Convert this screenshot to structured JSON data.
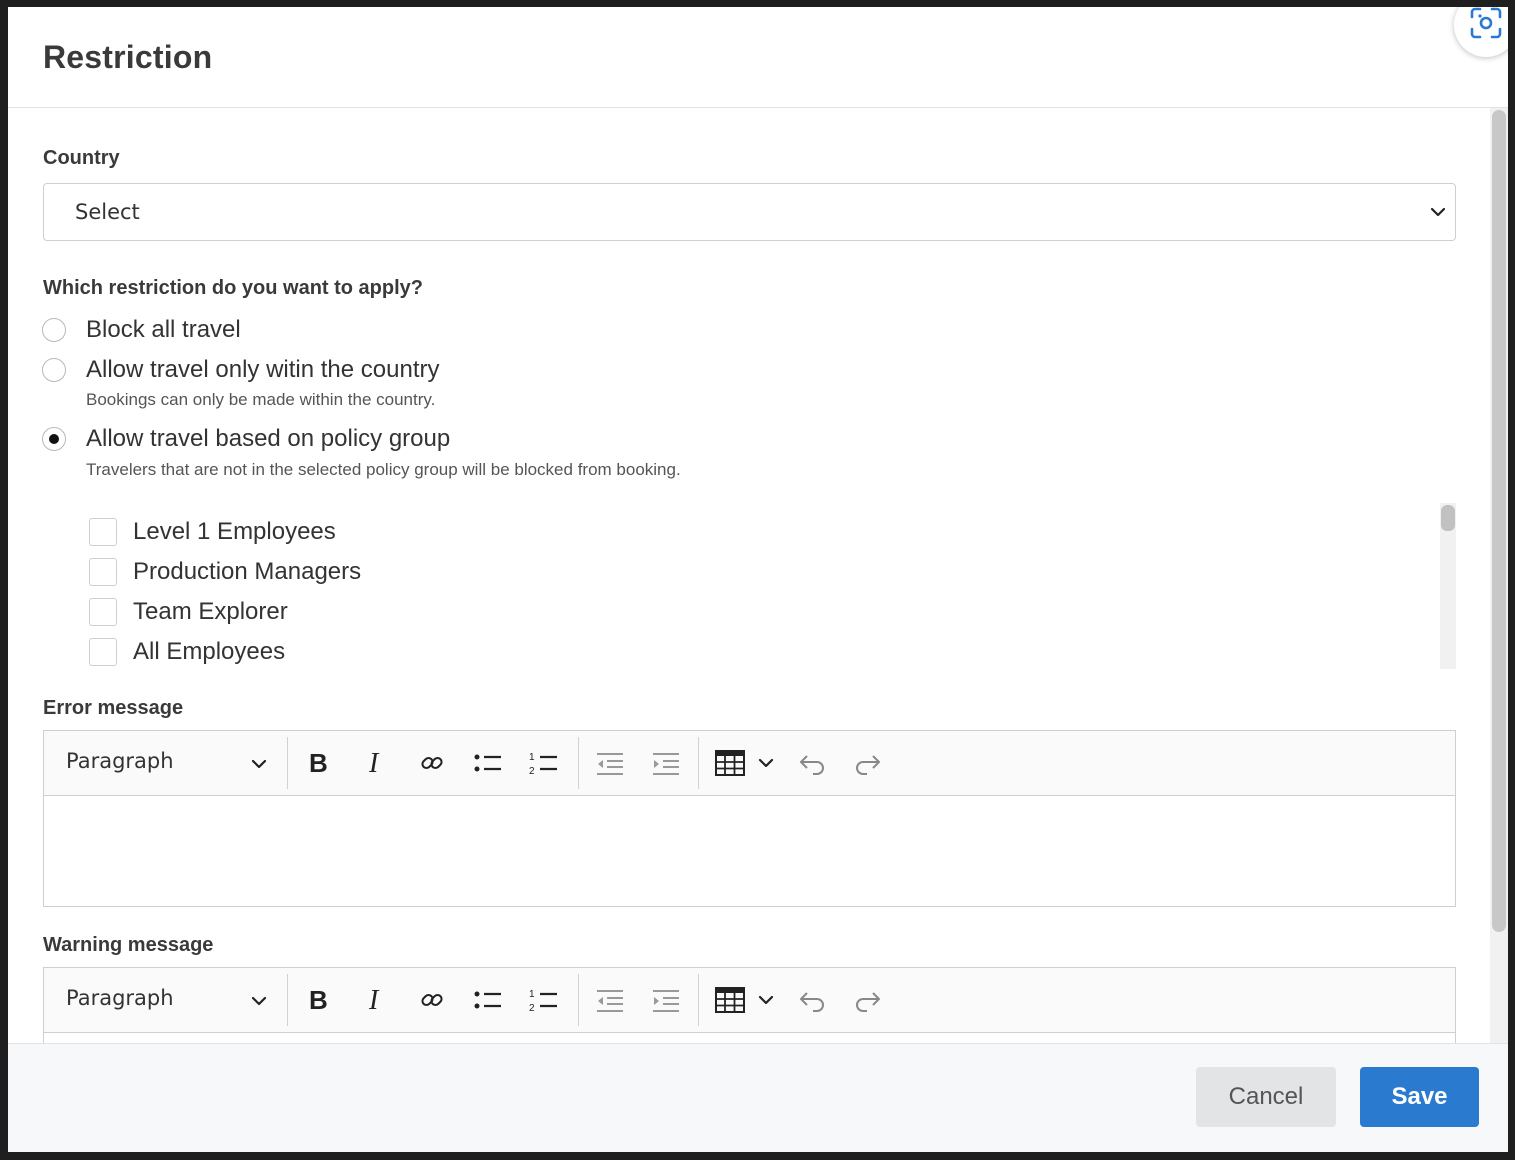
{
  "modal": {
    "title": "Restriction"
  },
  "country": {
    "label": "Country",
    "value": "Select"
  },
  "restriction": {
    "question": "Which restriction do you want to apply?",
    "options": [
      {
        "label": "Block all travel",
        "help": "",
        "checked": false
      },
      {
        "label": "Allow travel only witin the country",
        "help": "Bookings can only be made within the country.",
        "checked": false
      },
      {
        "label": "Allow travel based on policy group",
        "help": "Travelers that are not in the selected policy group will be blocked from booking.",
        "checked": true
      }
    ]
  },
  "policy_groups": [
    {
      "label": "Level 1 Employees",
      "checked": false
    },
    {
      "label": "Production Managers",
      "checked": false
    },
    {
      "label": "Team Explorer",
      "checked": false
    },
    {
      "label": "All Employees",
      "checked": false
    }
  ],
  "error_editor": {
    "label": "Error message",
    "block_format": "Paragraph"
  },
  "warning_editor": {
    "label": "Warning message",
    "block_format": "Paragraph"
  },
  "footer": {
    "cancel_label": "Cancel",
    "save_label": "Save"
  },
  "colors": {
    "primary": "#2a7ad0",
    "cancel_bg": "#e3e4e6"
  }
}
